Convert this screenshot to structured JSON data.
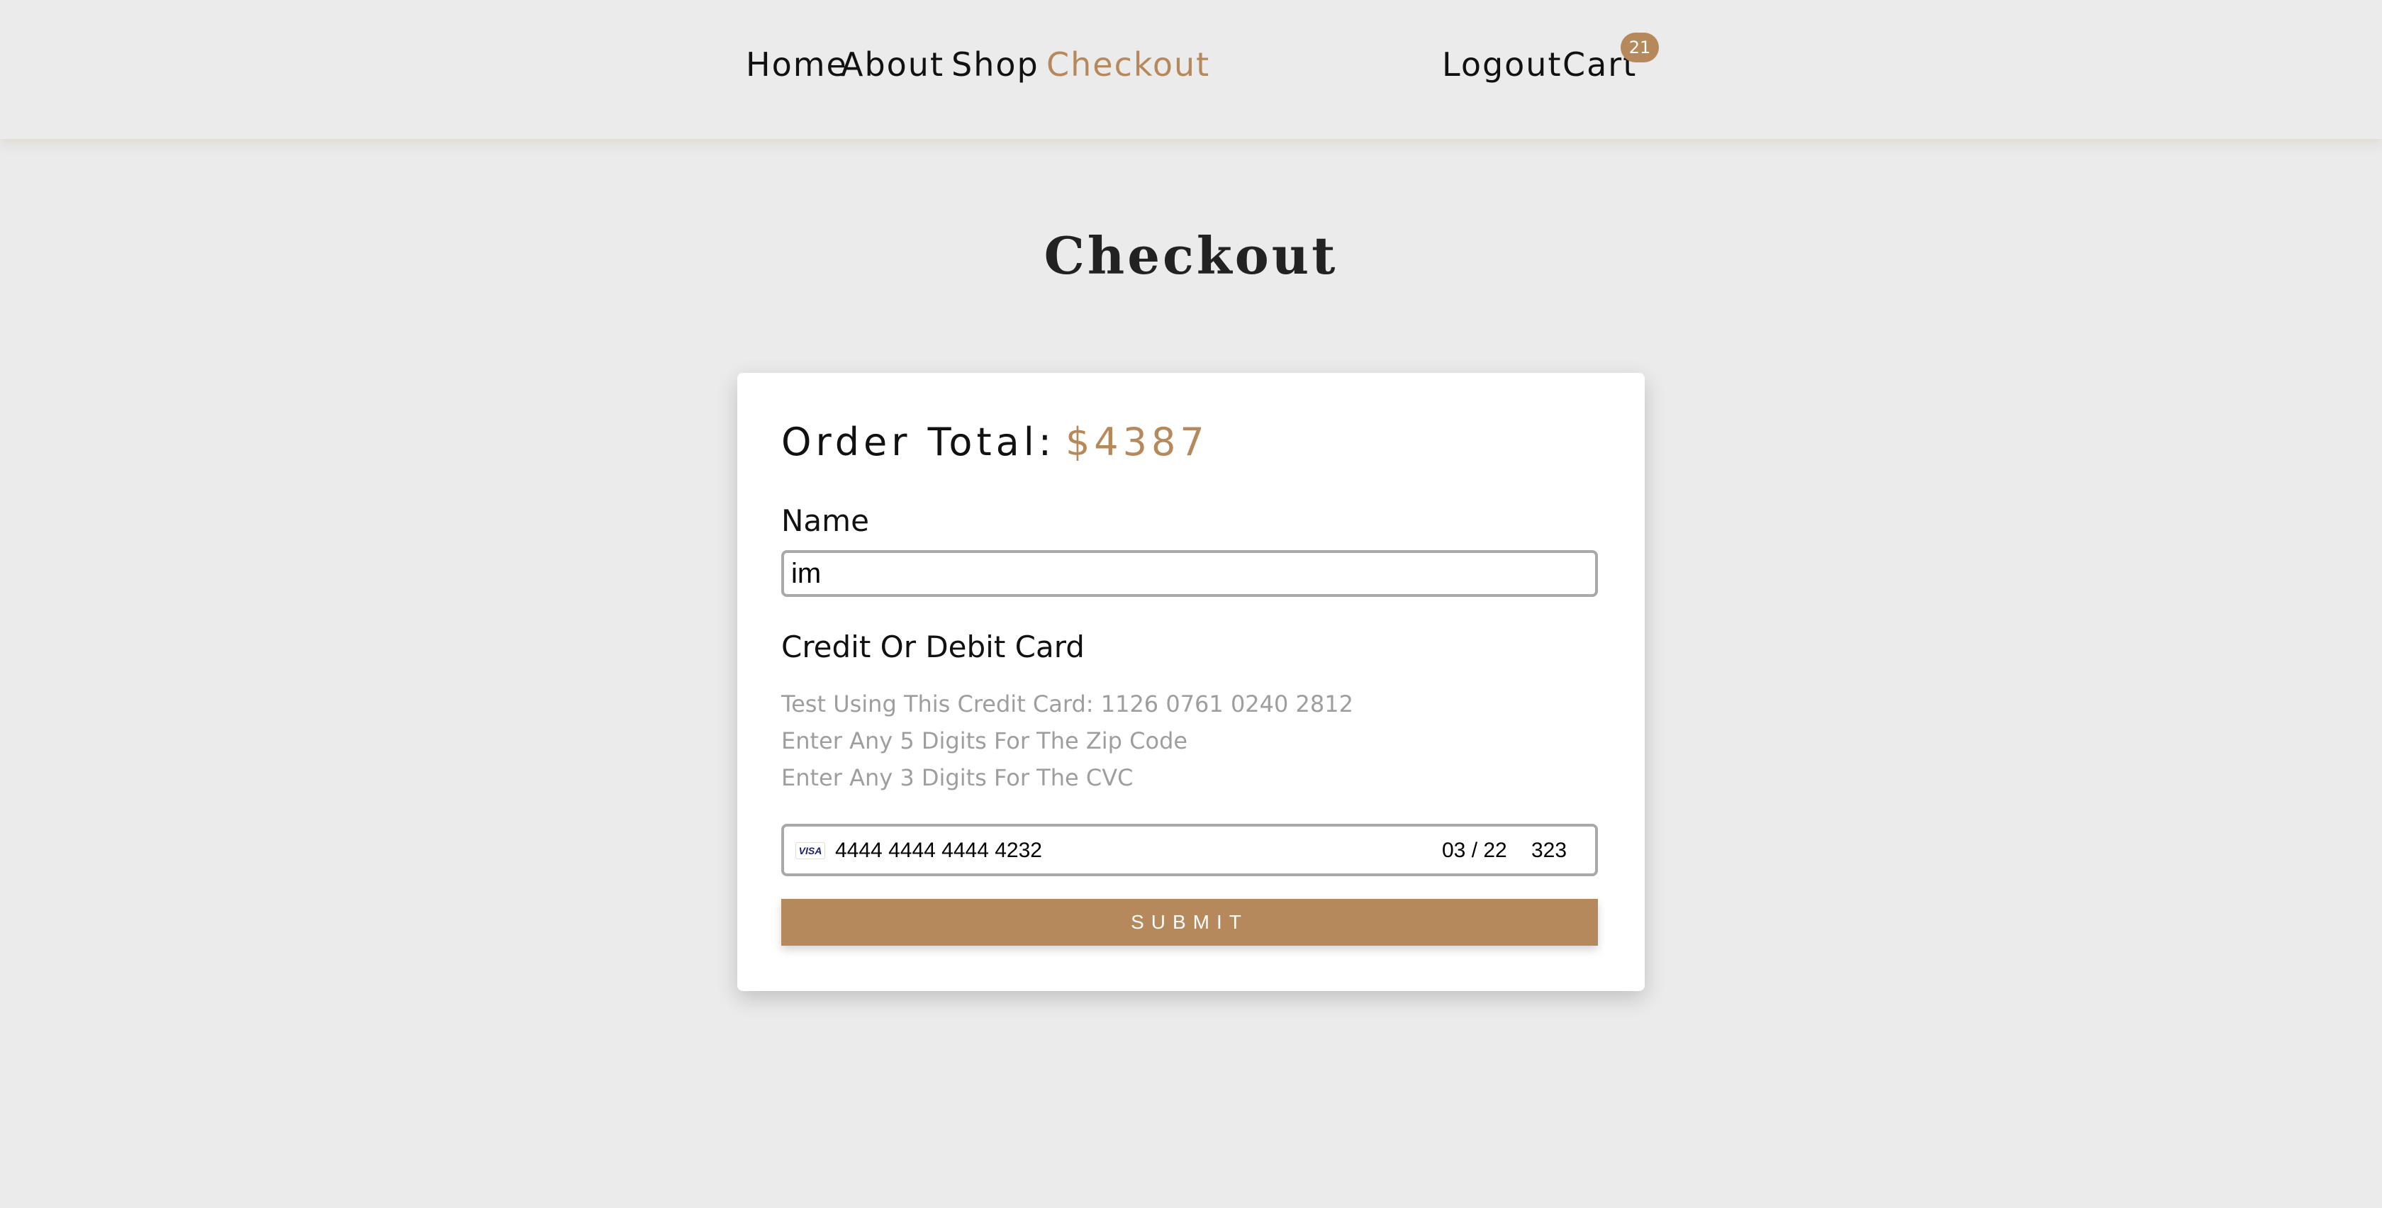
{
  "nav": {
    "home": "Home",
    "about": "About",
    "shop": "Shop",
    "checkout": "Checkout",
    "logout": "Logout",
    "cart": "Cart",
    "cart_count": "21"
  },
  "page": {
    "title": "Checkout"
  },
  "form": {
    "order_total_label": "Order Total:",
    "order_total_value": "$4387",
    "name_label": "Name",
    "name_value": "im",
    "card_label": "Credit Or Debit Card",
    "hints": [
      "Test Using This Credit Card: 1126 0761 0240 2812",
      "Enter Any 5 Digits For The Zip Code",
      "Enter Any 3 Digits For The CVC"
    ],
    "card_brand": "VISA",
    "card_number": "4444 4444 4444 4232",
    "card_expiry": "03 / 22",
    "card_cvc": "323",
    "submit_label": "SUBMIT"
  },
  "colors": {
    "accent": "#b5895c",
    "background": "#ebebeb",
    "card": "#ffffff",
    "hint_text": "#9e9e9e"
  },
  "icons": {
    "card_brand_icon": "visa-icon"
  }
}
